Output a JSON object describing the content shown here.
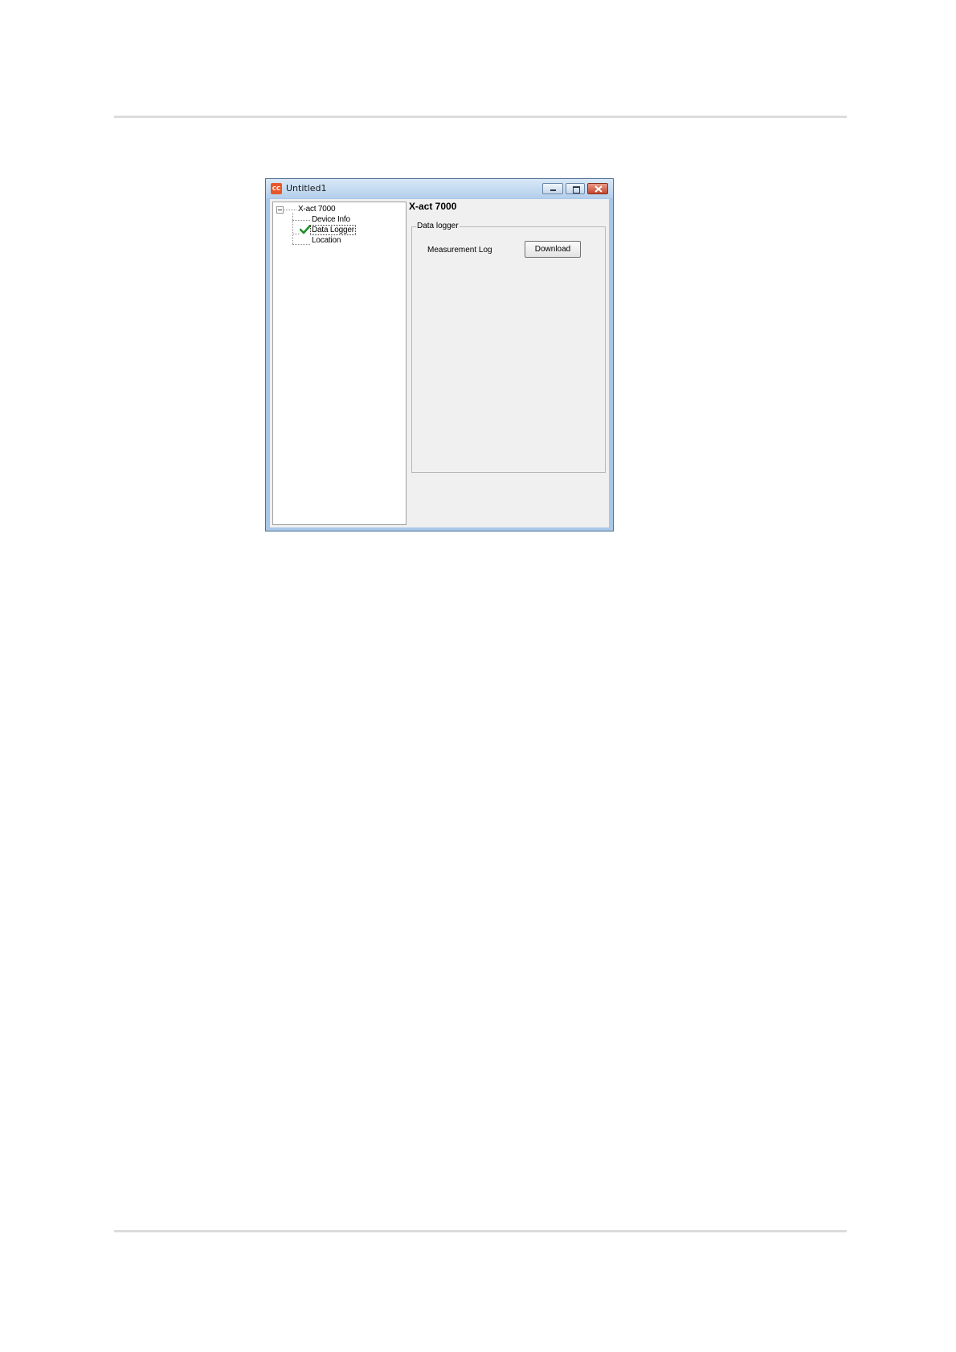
{
  "window": {
    "title": "Untitled1",
    "app_icon_text": "CC",
    "accent_color": "#e8572a"
  },
  "tree": {
    "root": "X-act 7000",
    "items": [
      {
        "label": "Device Info",
        "selected": false
      },
      {
        "label": "Data Logger",
        "selected": true,
        "icon": "checkmark-icon"
      },
      {
        "label": "Location",
        "selected": false
      }
    ]
  },
  "panel": {
    "device_title": "X-act 7000",
    "group_label": "Data logger",
    "measurement_log_label": "Measurement Log",
    "download_label": "Download"
  }
}
